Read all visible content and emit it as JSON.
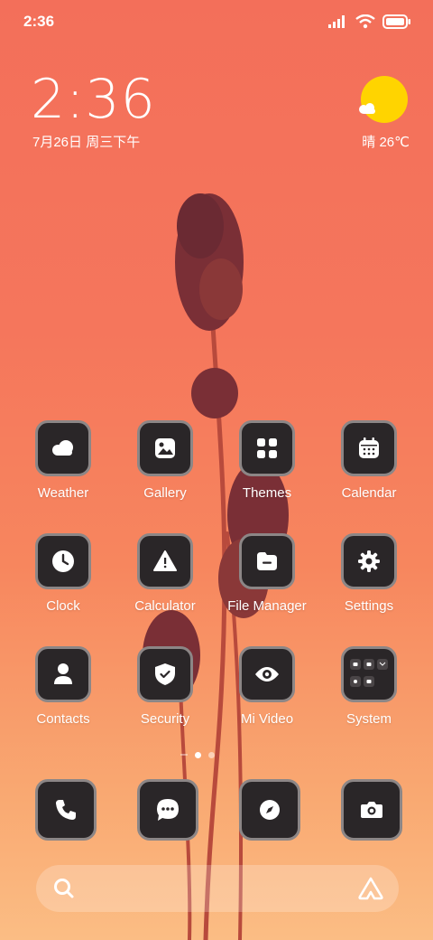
{
  "status_bar": {
    "time": "2:36",
    "icons": [
      "signal-icon",
      "wifi-icon",
      "battery-icon"
    ]
  },
  "lock_clock": {
    "time": "2:36",
    "date": "7月26日 周三下午"
  },
  "weather_widget": {
    "icon": "sun-cloud-icon",
    "text": "晴 26℃"
  },
  "apps": [
    {
      "label": "Weather",
      "icon": "weather-icon"
    },
    {
      "label": "Gallery",
      "icon": "gallery-icon"
    },
    {
      "label": "Themes",
      "icon": "themes-icon"
    },
    {
      "label": "Calendar",
      "icon": "calendar-icon"
    },
    {
      "label": "Clock",
      "icon": "clock-icon"
    },
    {
      "label": "Calculator",
      "icon": "calculator-icon"
    },
    {
      "label": "File Manager",
      "icon": "file-manager-icon"
    },
    {
      "label": "Settings",
      "icon": "gear-icon"
    },
    {
      "label": "Contacts",
      "icon": "contacts-icon"
    },
    {
      "label": "Security",
      "icon": "shield-icon"
    },
    {
      "label": "Mi Video",
      "icon": "eye-icon"
    },
    {
      "label": "System",
      "icon": "folder-icon"
    }
  ],
  "page_indicator": {
    "pages": 2,
    "active": 1
  },
  "dock": [
    "phone-icon",
    "messages-icon",
    "browser-icon",
    "camera-icon"
  ],
  "search_bar": {
    "left_icon": "search-icon",
    "right_icon": "assistant-icon"
  },
  "colors": {
    "wallpaper_top": "#f36f5a",
    "wallpaper_bottom": "#fbbd84",
    "icon_bg": "#2a2628",
    "icon_border": "#8c8686",
    "weather_sun": "#ffd400"
  }
}
